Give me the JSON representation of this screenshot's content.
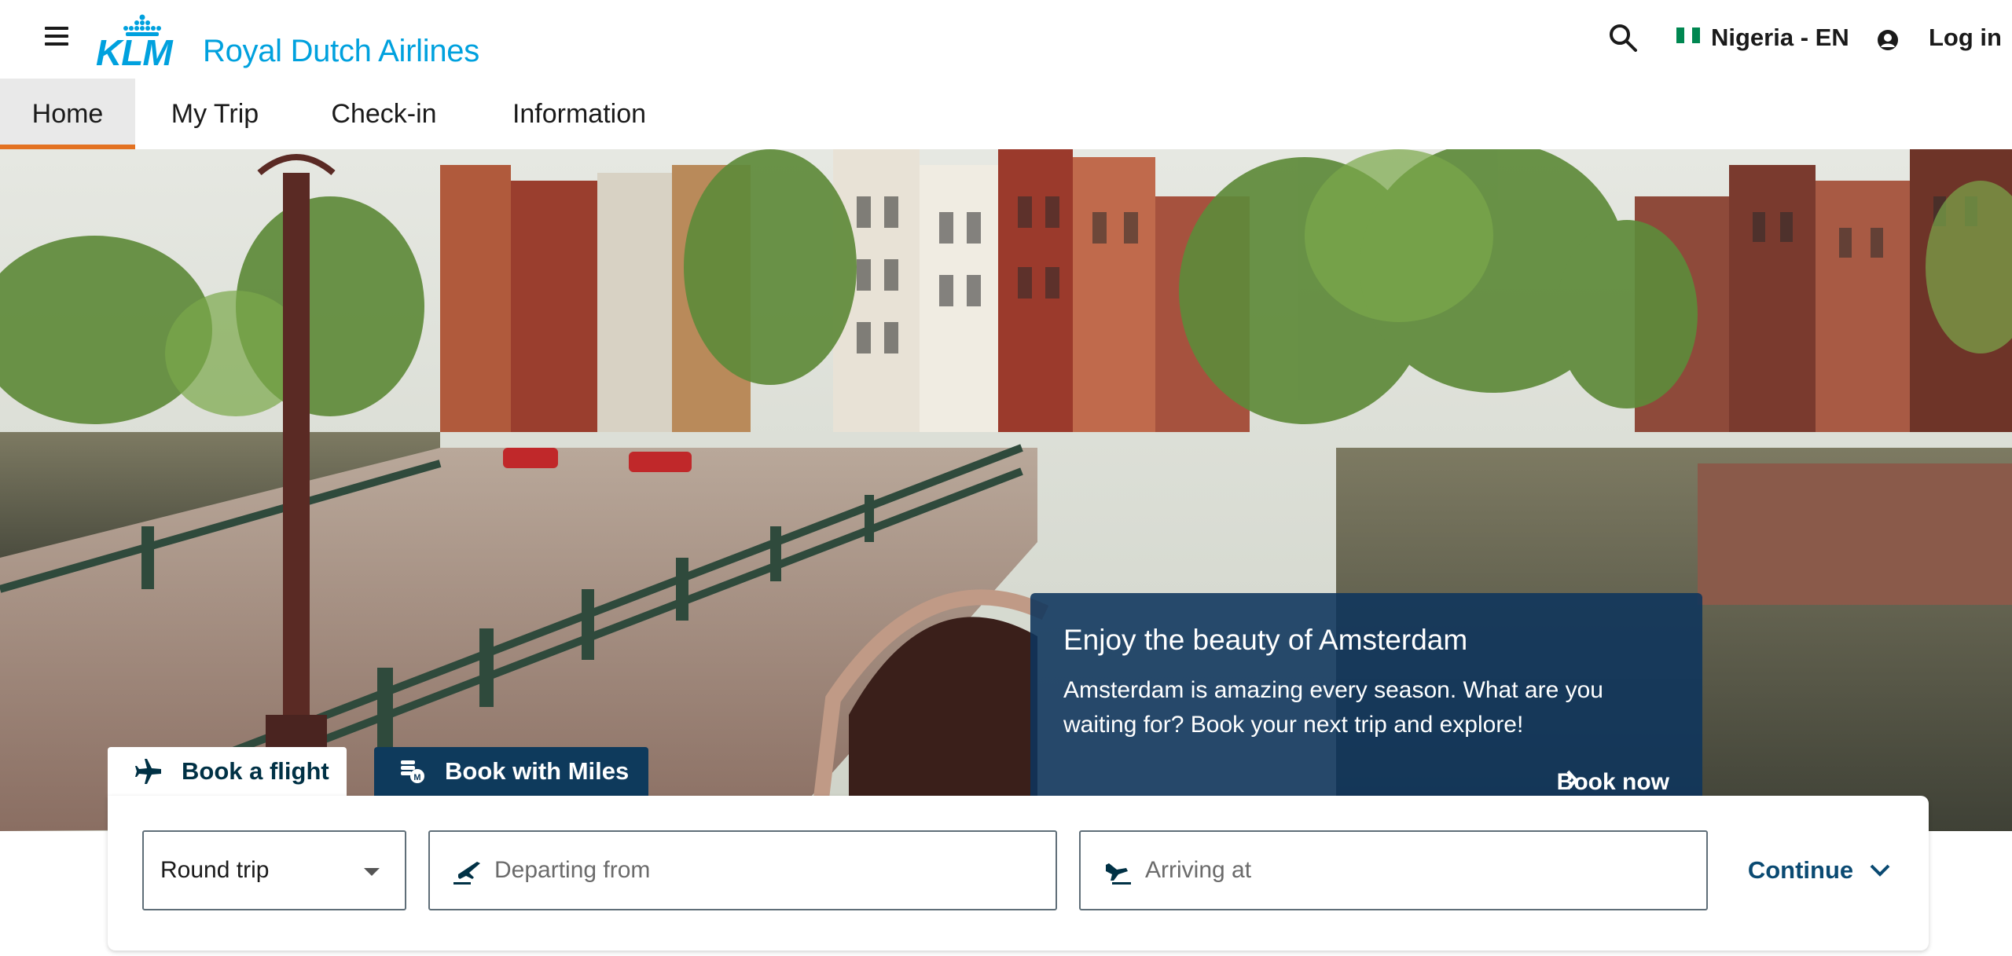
{
  "header": {
    "brand_mark": "KLM",
    "brand_name": "Royal Dutch Airlines",
    "language_label": "Nigeria - EN",
    "login_label": "Log in"
  },
  "nav": {
    "tabs": [
      {
        "label": "Home",
        "active": true
      },
      {
        "label": "My Trip",
        "active": false
      },
      {
        "label": "Check-in",
        "active": false
      },
      {
        "label": "Information",
        "active": false
      }
    ]
  },
  "promo": {
    "title": "Enjoy the beauty of Amsterdam",
    "text": "Amsterdam is amazing every season. What are you waiting for? Book your next trip and explore!",
    "cta_label": "Book now"
  },
  "booking": {
    "tabs": [
      {
        "label": "Book a flight",
        "selected": true,
        "icon": "plane-icon"
      },
      {
        "label": "Book with Miles",
        "selected": false,
        "icon": "miles-coin-icon"
      }
    ],
    "trip_type": "Round trip",
    "departing_placeholder": "Departing from",
    "arriving_placeholder": "Arriving at",
    "continue_label": "Continue"
  },
  "colors": {
    "brand_blue": "#00a1de",
    "nav_active_underline": "#e37222",
    "promo_background": "#0e345c",
    "miles_tab": "#0e3a5c",
    "link_blue": "#0a4a72"
  }
}
